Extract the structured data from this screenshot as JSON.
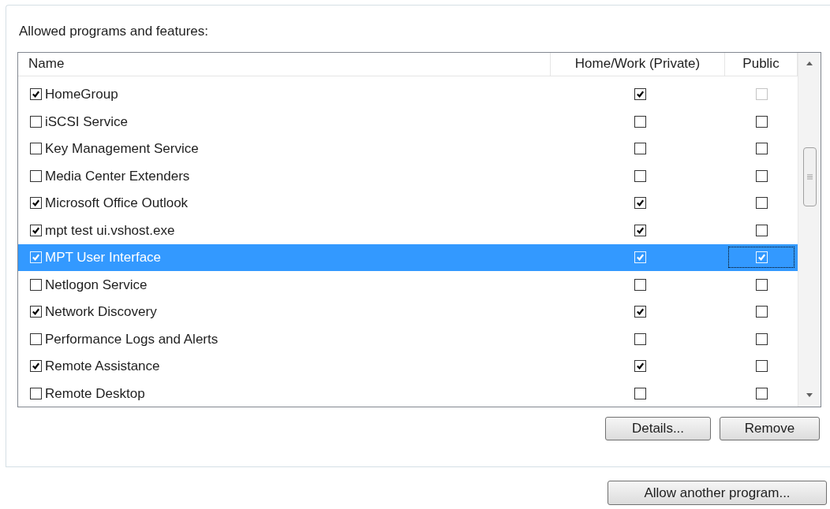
{
  "group_label": "Allowed programs and features:",
  "table": {
    "columns": [
      "Name",
      "Home/Work (Private)",
      "Public"
    ],
    "rows": [
      {
        "name": "HomeGroup",
        "checked": true,
        "selected": false,
        "private": {
          "checked": true
        },
        "public": {
          "checked": false,
          "disabled": true,
          "focused": false
        }
      },
      {
        "name": "iSCSI Service",
        "checked": false,
        "selected": false,
        "private": {
          "checked": false
        },
        "public": {
          "checked": false,
          "disabled": false,
          "focused": false
        }
      },
      {
        "name": "Key Management Service",
        "checked": false,
        "selected": false,
        "private": {
          "checked": false
        },
        "public": {
          "checked": false,
          "disabled": false,
          "focused": false
        }
      },
      {
        "name": "Media Center Extenders",
        "checked": false,
        "selected": false,
        "private": {
          "checked": false
        },
        "public": {
          "checked": false,
          "disabled": false,
          "focused": false
        }
      },
      {
        "name": "Microsoft Office Outlook",
        "checked": true,
        "selected": false,
        "private": {
          "checked": true
        },
        "public": {
          "checked": false,
          "disabled": false,
          "focused": false
        }
      },
      {
        "name": "mpt test ui.vshost.exe",
        "checked": true,
        "selected": false,
        "private": {
          "checked": true
        },
        "public": {
          "checked": false,
          "disabled": false,
          "focused": false
        }
      },
      {
        "name": "MPT User Interface",
        "checked": true,
        "selected": true,
        "private": {
          "checked": true
        },
        "public": {
          "checked": true,
          "disabled": false,
          "focused": true
        }
      },
      {
        "name": "Netlogon Service",
        "checked": false,
        "selected": false,
        "private": {
          "checked": false
        },
        "public": {
          "checked": false,
          "disabled": false,
          "focused": false
        }
      },
      {
        "name": "Network Discovery",
        "checked": true,
        "selected": false,
        "private": {
          "checked": true
        },
        "public": {
          "checked": false,
          "disabled": false,
          "focused": false
        }
      },
      {
        "name": "Performance Logs and Alerts",
        "checked": false,
        "selected": false,
        "private": {
          "checked": false
        },
        "public": {
          "checked": false,
          "disabled": false,
          "focused": false
        }
      },
      {
        "name": "Remote Assistance",
        "checked": true,
        "selected": false,
        "private": {
          "checked": true
        },
        "public": {
          "checked": false,
          "disabled": false,
          "focused": false
        }
      },
      {
        "name": "Remote Desktop",
        "checked": false,
        "selected": false,
        "private": {
          "checked": false
        },
        "public": {
          "checked": false,
          "disabled": false,
          "focused": false
        }
      }
    ]
  },
  "table_buttons": [
    "Details...",
    "Remove"
  ],
  "bottom_button": "Allow another program..."
}
